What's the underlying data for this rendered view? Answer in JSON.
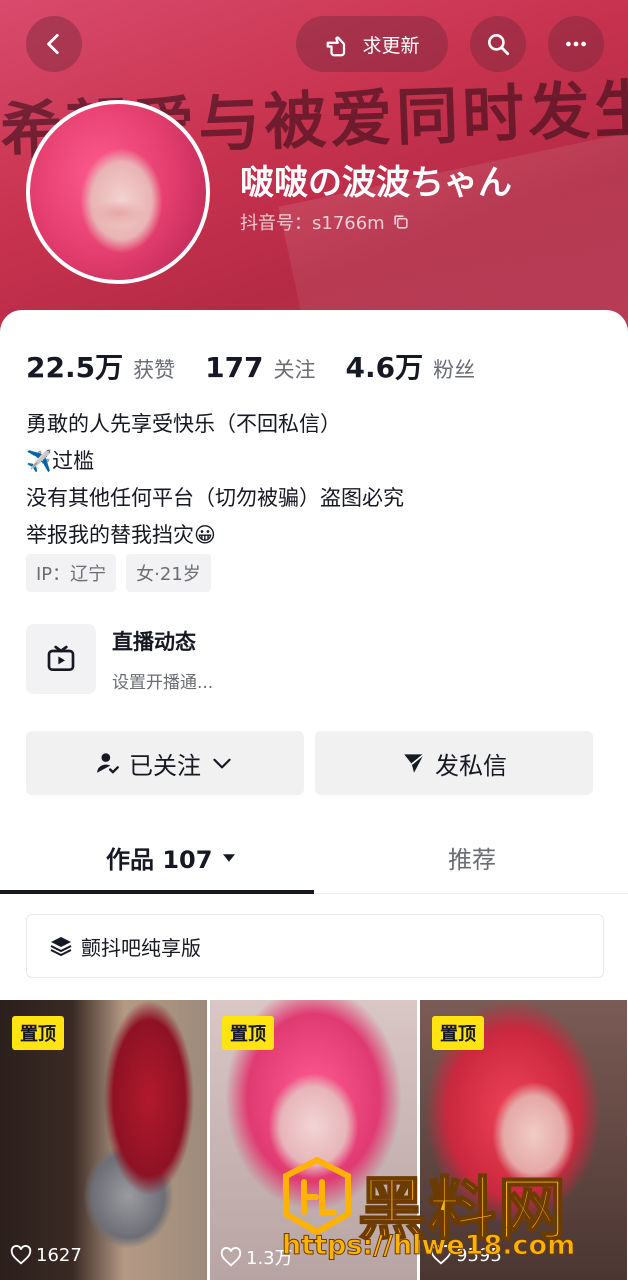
{
  "header": {
    "banner_quote": "希望爱与被爱同时发生。",
    "request_update_label": "求更新"
  },
  "profile": {
    "display_name": "啵啵の波波ちゃん",
    "douyin_id": "抖音号：s1766m"
  },
  "stats": [
    {
      "value": "22.5万",
      "label": "获赞"
    },
    {
      "value": "177",
      "label": "关注"
    },
    {
      "value": "4.6万",
      "label": "粉丝"
    }
  ],
  "bio": [
    "勇敢的人先享受快乐（不回私信）",
    "✈️过槛",
    "没有其他任何平台（切勿被骗）盗图必究",
    "举报我的替我挡灾😀"
  ],
  "tags": [
    "IP：辽宁",
    "女·21岁"
  ],
  "live": {
    "title": "直播动态",
    "subtitle": "设置开播通..."
  },
  "actions": {
    "follow_label": "已关注",
    "message_label": "发私信"
  },
  "tabs": {
    "works_label": "作品 107",
    "recommend_label": "推荐"
  },
  "collection": {
    "label": "颤抖吧纯享版"
  },
  "videos": [
    {
      "pin_label": "置顶",
      "likes": "1627"
    },
    {
      "pin_label": "置顶",
      "likes": "1.3万"
    },
    {
      "pin_label": "置顶",
      "likes": "9595"
    }
  ],
  "watermark": {
    "brand": "黑料网",
    "url": "https://hlwe18.com"
  },
  "colors": {
    "banner": "#c8334f",
    "pin": "#ffe411",
    "watermark": "#ffb300"
  }
}
